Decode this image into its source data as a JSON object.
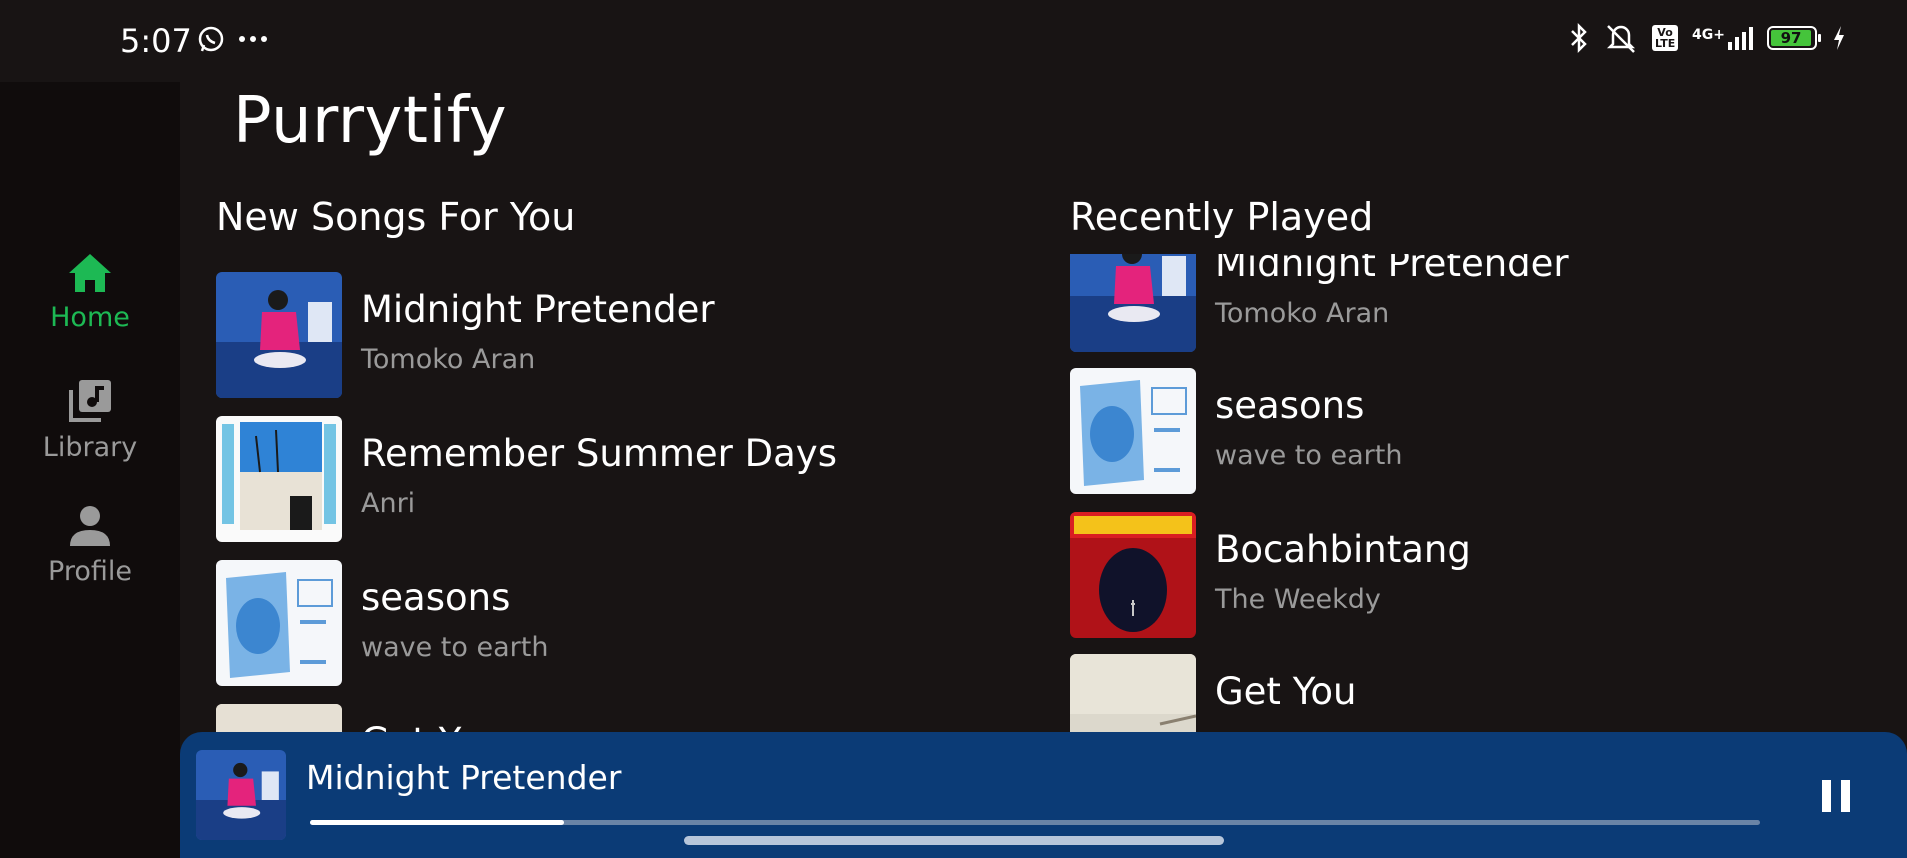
{
  "status_bar": {
    "time": "5:07",
    "left_icons": [
      "whatsapp-icon",
      "more-dots-icon"
    ],
    "right_icons": [
      "bluetooth-icon",
      "mute-bell-icon",
      "volte-icon",
      "signal-4g-icon",
      "battery-icon",
      "charging-icon"
    ],
    "network_label": "4G+",
    "volte_label": "Vo LTE",
    "battery": "97"
  },
  "sidebar": {
    "items": [
      {
        "label": "Home",
        "icon": "home-icon",
        "active": true
      },
      {
        "label": "Library",
        "icon": "library-icon",
        "active": false
      },
      {
        "label": "Profile",
        "icon": "profile-icon",
        "active": false
      }
    ]
  },
  "app": {
    "title": "Purrytify"
  },
  "new_songs": {
    "title": "New Songs For You",
    "items": [
      {
        "title": "Midnight Pretender",
        "artist": "Tomoko Aran"
      },
      {
        "title": "Remember Summer Days",
        "artist": "Anri"
      },
      {
        "title": "seasons",
        "artist": "wave to earth"
      },
      {
        "title": "Get You",
        "artist": ""
      }
    ]
  },
  "recently_played": {
    "title": "Recently Played",
    "items": [
      {
        "title": "Midnight Pretender",
        "artist": "Tomoko Aran"
      },
      {
        "title": "seasons",
        "artist": "wave to earth"
      },
      {
        "title": "Bocahbintang",
        "artist": "The Weekdy"
      },
      {
        "title": "Get You",
        "artist": ""
      }
    ]
  },
  "player": {
    "title": "Midnight Pretender",
    "progress": 0.175,
    "state": "playing"
  },
  "colors": {
    "accent": "#1db954",
    "player_bg": "#0b3b76",
    "background": "#181414",
    "sidebar_bg": "#100c0c"
  }
}
